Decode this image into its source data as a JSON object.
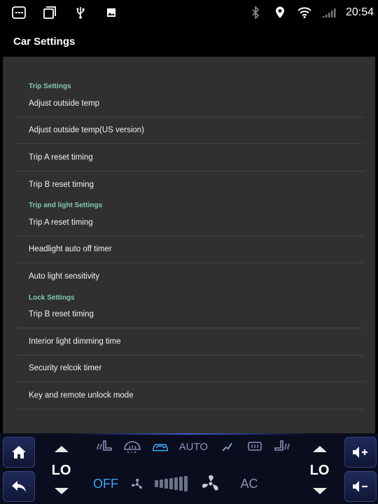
{
  "status_bar": {
    "left_icons": [
      "menu-box-icon",
      "recent-apps-icon",
      "usb-icon",
      "image-icon"
    ],
    "right_icons": [
      "bluetooth-icon",
      "location-icon",
      "wifi-icon",
      "signal-icon"
    ],
    "time": "20:54"
  },
  "app_bar": {
    "title": "Car Settings"
  },
  "sections": [
    {
      "header": "Trip Settings",
      "items": [
        "Adjust outside temp",
        "Adjust outside temp(US version)",
        "Trip A reset timing",
        "Trip B reset timing"
      ]
    },
    {
      "header": "Trip and light Settings",
      "items": [
        "Trip A reset timing",
        "Headlight auto off timer",
        "Auto light sensitivity"
      ]
    },
    {
      "header": "Lock Settings",
      "items": [
        "Trip B reset timing",
        "Interior light dimming time",
        "Security relcok timer",
        "Key and remote unlock mode"
      ]
    }
  ],
  "climate": {
    "left_temp": "LO",
    "right_temp": "LO",
    "auto_label": "AUTO",
    "off_label": "OFF",
    "ac_label": "AC",
    "fan_level": 0,
    "fan_levels_total": 7,
    "mode_icons": [
      "seat-heat-left-icon",
      "front-defrost-icon",
      "recirculation-icon",
      "airflow-icon",
      "rear-defrost-icon",
      "seat-heat-right-icon"
    ],
    "colors": {
      "accent": "#3aa9ff",
      "section_header": "#7fc9b6",
      "panel_bg": "#303030"
    }
  }
}
